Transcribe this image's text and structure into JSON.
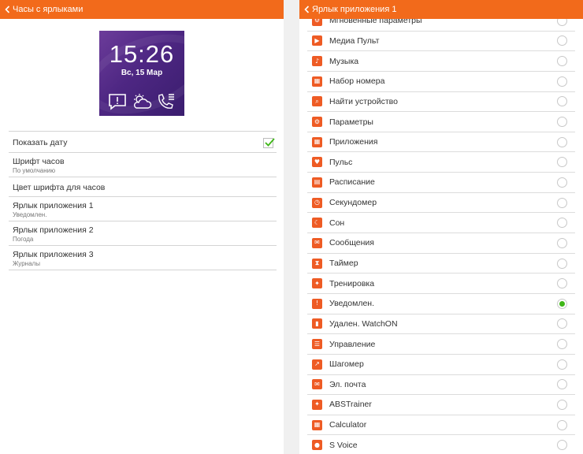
{
  "left": {
    "title": "Часы с ярлыками",
    "watch": {
      "time": "15:26",
      "date": "Вс, 15 Мар",
      "icons": [
        "notification-icon",
        "weather-icon",
        "call-log-icon"
      ]
    },
    "settings": [
      {
        "title": "Показать дату",
        "checked": true
      },
      {
        "title": "Шрифт часов",
        "subtitle": "По умолчанию"
      },
      {
        "title": "Цвет шрифта для часов"
      },
      {
        "title": "Ярлык приложения 1",
        "subtitle": "Уведомлен."
      },
      {
        "title": "Ярлык приложения 2",
        "subtitle": "Погода"
      },
      {
        "title": "Ярлык приложения 3",
        "subtitle": "Журналы"
      }
    ]
  },
  "right": {
    "title": "Ярлык приложения 1",
    "apps": [
      {
        "label": "Мгновенные параметры",
        "icon": "instant-settings-icon",
        "glyph": "⚙",
        "selected": false
      },
      {
        "label": "Медиа Пульт",
        "icon": "media-controller-icon",
        "glyph": "▶",
        "selected": false
      },
      {
        "label": "Музыка",
        "icon": "music-icon",
        "glyph": "♪",
        "selected": false
      },
      {
        "label": "Набор номера",
        "icon": "dialer-icon",
        "glyph": "▦",
        "selected": false
      },
      {
        "label": "Найти устройство",
        "icon": "find-device-icon",
        "glyph": "⌕",
        "selected": false
      },
      {
        "label": "Параметры",
        "icon": "settings-icon",
        "glyph": "⚙",
        "selected": false
      },
      {
        "label": "Приложения",
        "icon": "apps-icon",
        "glyph": "▦",
        "selected": false
      },
      {
        "label": "Пульс",
        "icon": "heart-rate-icon",
        "glyph": "♥",
        "selected": false
      },
      {
        "label": "Расписание",
        "icon": "schedule-icon",
        "glyph": "▤",
        "selected": false
      },
      {
        "label": "Секундомер",
        "icon": "stopwatch-icon",
        "glyph": "◷",
        "selected": false
      },
      {
        "label": "Сон",
        "icon": "sleep-icon",
        "glyph": "☾",
        "selected": false
      },
      {
        "label": "Сообщения",
        "icon": "messages-icon",
        "glyph": "✉",
        "selected": false
      },
      {
        "label": "Таймер",
        "icon": "timer-icon",
        "glyph": "⧗",
        "selected": false
      },
      {
        "label": "Тренировка",
        "icon": "exercise-icon",
        "glyph": "✦",
        "selected": false
      },
      {
        "label": "Уведомлен.",
        "icon": "notifications-icon",
        "glyph": "!",
        "selected": true
      },
      {
        "label": "Удален. WatchON",
        "icon": "watchon-remote-icon",
        "glyph": "▮",
        "selected": false
      },
      {
        "label": "Управление",
        "icon": "controls-icon",
        "glyph": "☰",
        "selected": false
      },
      {
        "label": "Шагомер",
        "icon": "pedometer-icon",
        "glyph": "↗",
        "selected": false
      },
      {
        "label": "Эл. почта",
        "icon": "email-icon",
        "glyph": "✉",
        "selected": false
      },
      {
        "label": "ABSTrainer",
        "icon": "abs-trainer-icon",
        "glyph": "✦",
        "selected": false
      },
      {
        "label": "Calculator",
        "icon": "calculator-icon",
        "glyph": "▦",
        "selected": false
      },
      {
        "label": "S Voice",
        "icon": "s-voice-icon",
        "glyph": "●",
        "selected": false
      }
    ]
  },
  "colors": {
    "accent": "#f26a1b",
    "icon_bg": "#ee5b24",
    "radio_on": "#3fb618",
    "check": "#3fb618",
    "watch_bg": "#4e2783"
  }
}
